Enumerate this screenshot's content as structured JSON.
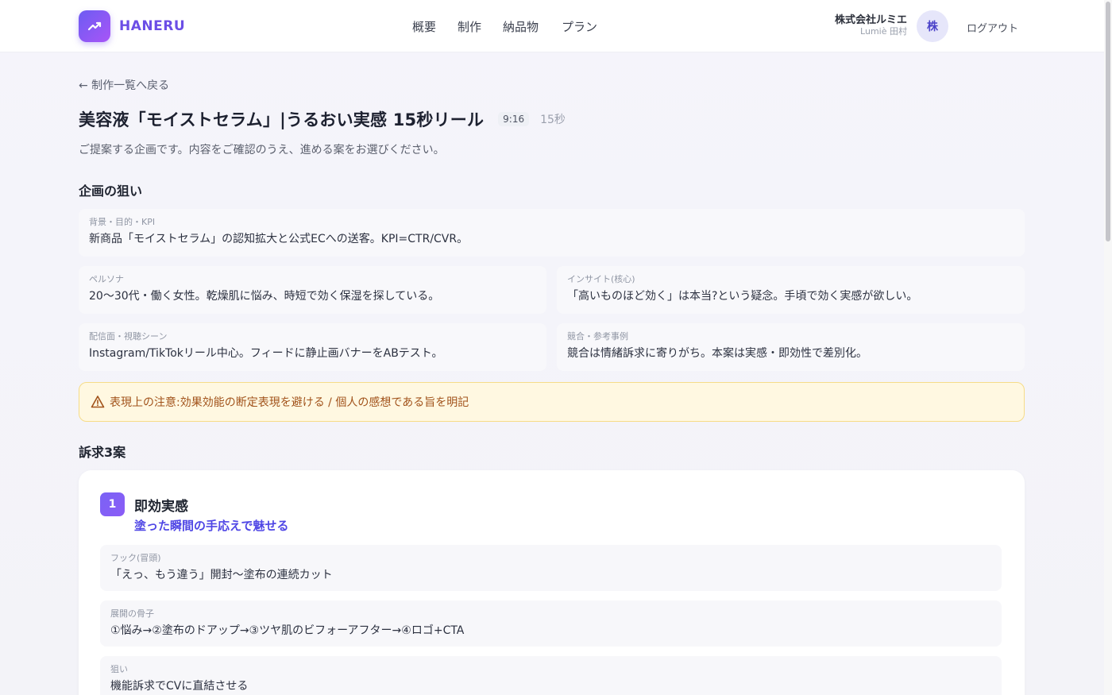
{
  "header": {
    "logo_text": "HANERU",
    "nav": [
      "概要",
      "制作",
      "納品物",
      "プラン"
    ],
    "company": "株式会社ルミエ",
    "user_sub": "Lumiè 田村",
    "avatar_char": "株",
    "logout": "ログアウト"
  },
  "page": {
    "back_link": "← 制作一覧へ戻る",
    "title": "美容液「モイストセラム」|うるおい実感 15秒リール",
    "ratio": "9:16",
    "duration": "15秒",
    "lead": "ご提案する企画です。内容をご確認のうえ、進める案をお選びください。"
  },
  "aim": {
    "heading": "企画の狙い",
    "cards": [
      {
        "label": "背景・目的・KPI",
        "text": "新商品「モイストセラム」の認知拡大と公式ECへの送客。KPI=CTR/CVR。"
      },
      {
        "label": "ペルソナ",
        "text": "20〜30代・働く女性。乾燥肌に悩み、時短で効く保湿を探している。"
      },
      {
        "label": "インサイト(核心)",
        "text": "「高いものほど効く」は本当?という疑念。手頃で効く実感が欲しい。"
      },
      {
        "label": "配信面・視聴シーン",
        "text": "Instagram/TikTokリール中心。フィードに静止画バナーをABテスト。"
      },
      {
        "label": "競合・参考事例",
        "text": "競合は情緒訴求に寄りがち。本案は実感・即効性で差別化。"
      }
    ]
  },
  "notice": {
    "icon": "warning-icon",
    "text": "表現上の注意:効果効能の断定表現を避ける / 個人の感想である旨を明記"
  },
  "appeals": {
    "heading": "訴求3案",
    "proposals": [
      {
        "number": "1",
        "title": "即効実感",
        "subtitle": "塗った瞬間の手応えで魅せる",
        "details": [
          {
            "label": "フック(冒頭)",
            "text": "「えっ、もう違う」開封〜塗布の連続カット"
          },
          {
            "label": "展開の骨子",
            "text": "①悩み→②塗布のドアップ→③ツヤ肌のビフォーアフター→④ロゴ+CTA"
          },
          {
            "label": "狙い",
            "text": "機能訴求でCVに直結させる"
          }
        ]
      }
    ]
  },
  "colors": {
    "brand": "#6b4ee6",
    "accent": "#4f46e5",
    "notice_bg": "#fff8e1",
    "notice_text": "#a1521a"
  }
}
